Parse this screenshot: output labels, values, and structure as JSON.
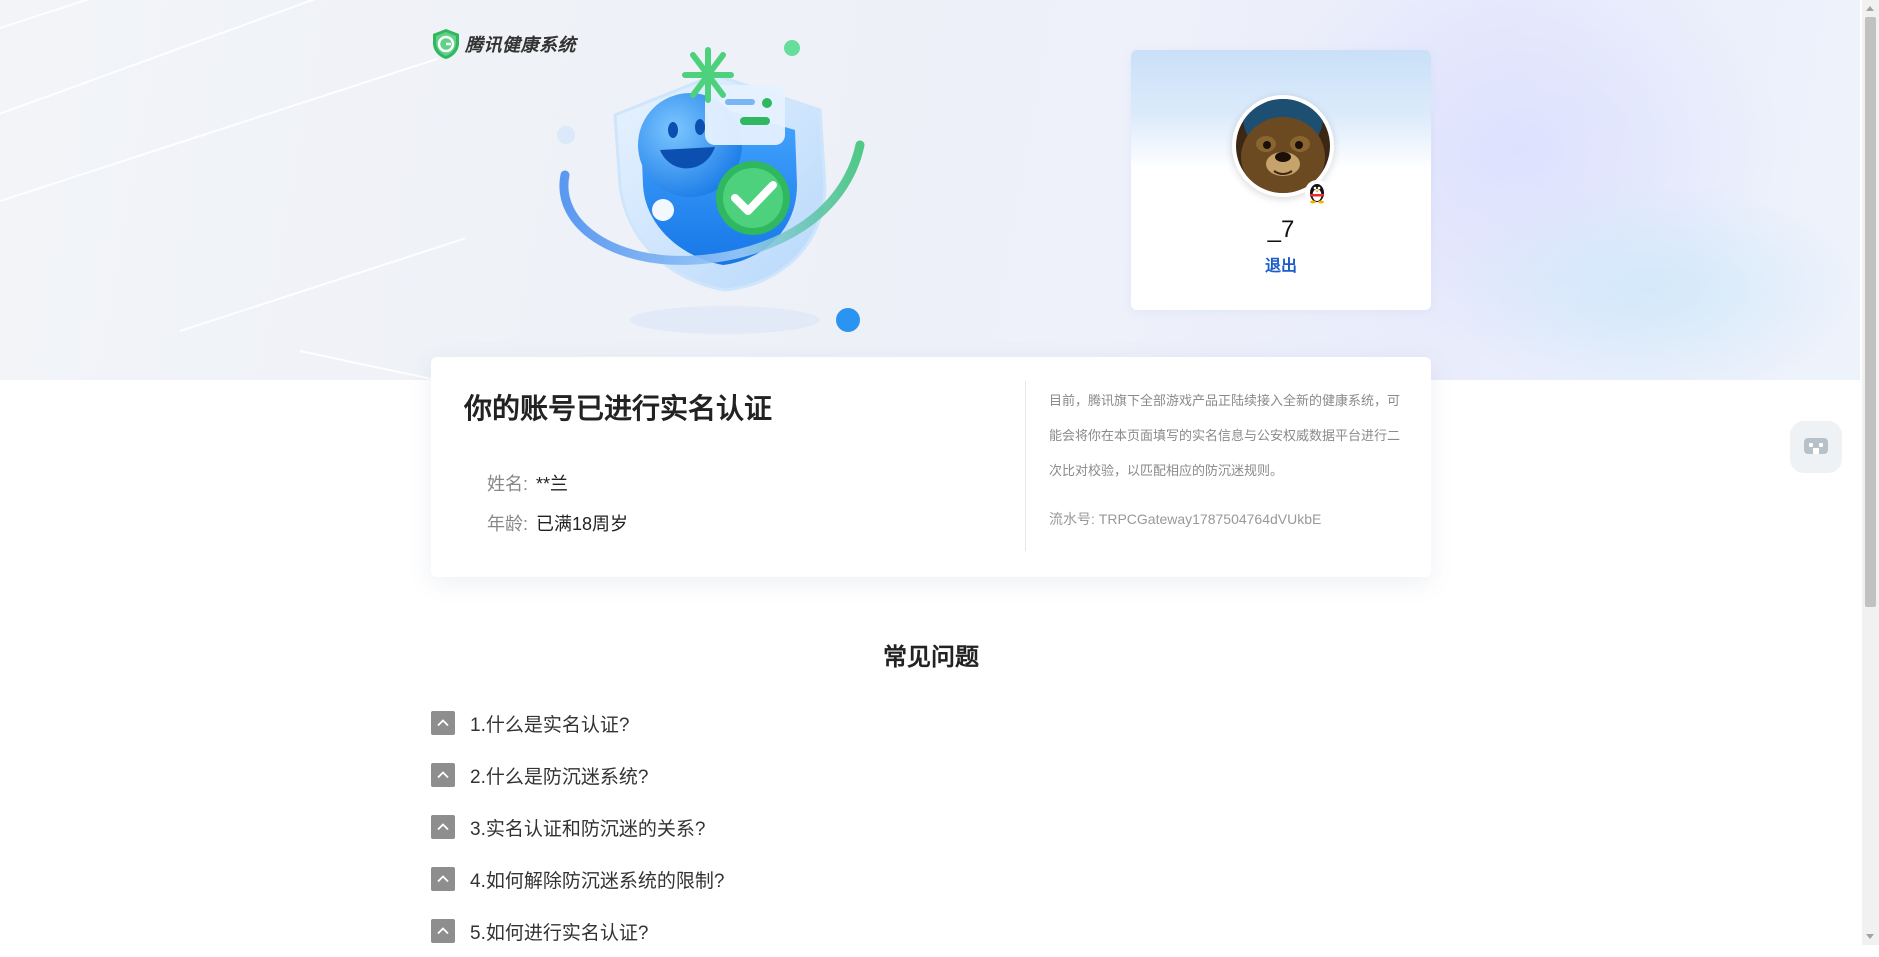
{
  "header": {
    "brand_name": "腾讯健康系统"
  },
  "user": {
    "nickname": "_7",
    "logout_label": "退出"
  },
  "verification": {
    "title": "你的账号已进行实名认证",
    "fields": [
      {
        "label": "姓名:",
        "value": "**兰"
      },
      {
        "label": "年龄:",
        "value": "已满18周岁"
      }
    ],
    "notice": "目前，腾讯旗下全部游戏产品正陆续接入全新的健康系统，可能会将你在本页面填写的实名信息与公安权威数据平台进行二次比对校验，以匹配相应的防沉迷规则。",
    "serial": "流水号: TRPCGateway1787504764dVUkbE"
  },
  "faq": {
    "title": "常见问题",
    "items": [
      "1.什么是实名认证?",
      "2.什么是防沉迷系统?",
      "3.实名认证和防沉迷的关系?",
      "4.如何解除防沉迷系统的限制?",
      "5.如何进行实名认证?"
    ]
  },
  "colors": {
    "accent_link": "#1a5dc9",
    "brand_green": "#2fb85f",
    "toggle_gray": "#8e8e8e"
  }
}
